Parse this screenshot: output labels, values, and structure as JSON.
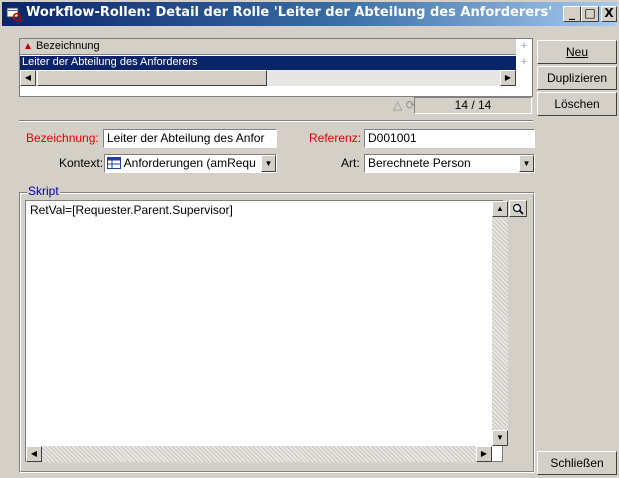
{
  "window": {
    "title": "Workflow-Rollen: Detail der Rolle 'Leiter der Abteilung des Anforderers'",
    "controls": {
      "minimize": "_",
      "maximize": "□",
      "close": "X"
    }
  },
  "list": {
    "column_header": "Bezeichnung",
    "rows": [
      "Leiter der Abteilung des Anforderers"
    ],
    "counter": "14 / 14"
  },
  "buttons": {
    "new": "Neu",
    "duplicate": "Duplizieren",
    "delete": "Löschen",
    "close": "Schließen"
  },
  "form": {
    "bezeichnung_label": "Bezeichnung:",
    "bezeichnung_value": "Leiter der Abteilung des Anfor",
    "referenz_label": "Referenz:",
    "referenz_value": "D001001",
    "kontext_label": "Kontext:",
    "kontext_value": "Anforderungen (amRequ",
    "art_label": "Art:",
    "art_value": "Berechnete Person"
  },
  "script": {
    "group_label": "Skript",
    "code": "RetVal=[Requester.Parent.Supervisor]"
  },
  "colors": {
    "selection": "#0a246a",
    "required_label": "#e00000",
    "face": "#d4d0c8"
  }
}
